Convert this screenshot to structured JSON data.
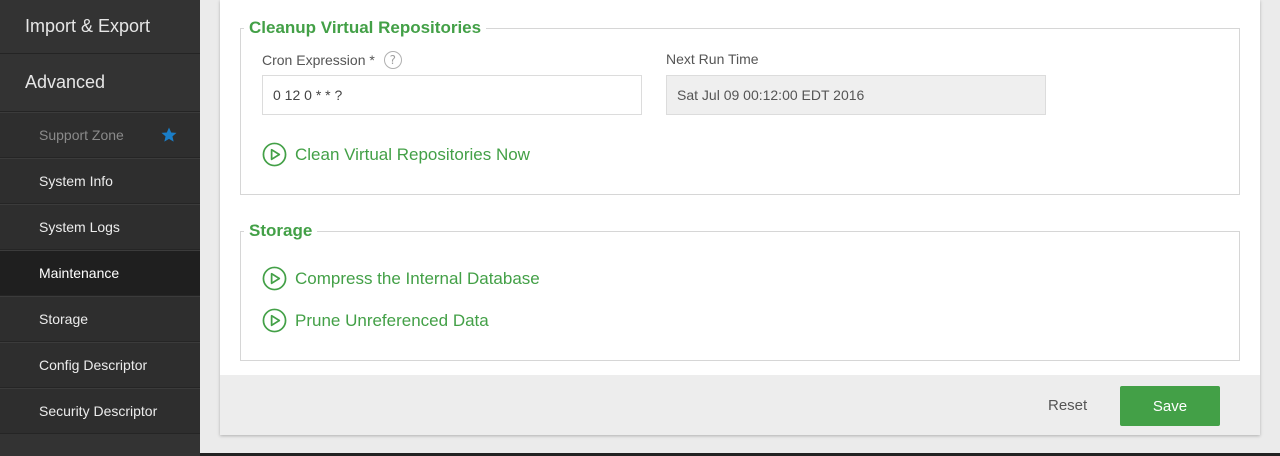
{
  "sidebar": {
    "top_items": [
      {
        "label": "Import & Export"
      },
      {
        "label": "Advanced"
      }
    ],
    "sub_items": [
      {
        "label": "Support Zone",
        "muted": true,
        "starred": true
      },
      {
        "label": "System Info"
      },
      {
        "label": "System Logs"
      },
      {
        "label": "Maintenance",
        "active": true
      },
      {
        "label": "Storage"
      },
      {
        "label": "Config Descriptor"
      },
      {
        "label": "Security Descriptor"
      }
    ],
    "star_color": "#1a7ec8"
  },
  "cleanup": {
    "title": "Cleanup Virtual Repositories",
    "cron_label": "Cron Expression *",
    "cron_help_icon": "question-circle-icon",
    "cron_value": "0 12 0 * * ?",
    "next_run_label": "Next Run Time",
    "next_run_value": "Sat Jul 09 00:12:00 EDT 2016",
    "action_label": "Clean Virtual Repositories Now"
  },
  "storage": {
    "title": "Storage",
    "actions": [
      {
        "label": "Compress the Internal Database"
      },
      {
        "label": "Prune Unreferenced Data"
      }
    ]
  },
  "footer": {
    "reset_label": "Reset",
    "save_label": "Save"
  },
  "colors": {
    "accent_green": "#43a047",
    "sidebar_bg": "#333333",
    "sidebar_active": "#1f1f1f"
  }
}
